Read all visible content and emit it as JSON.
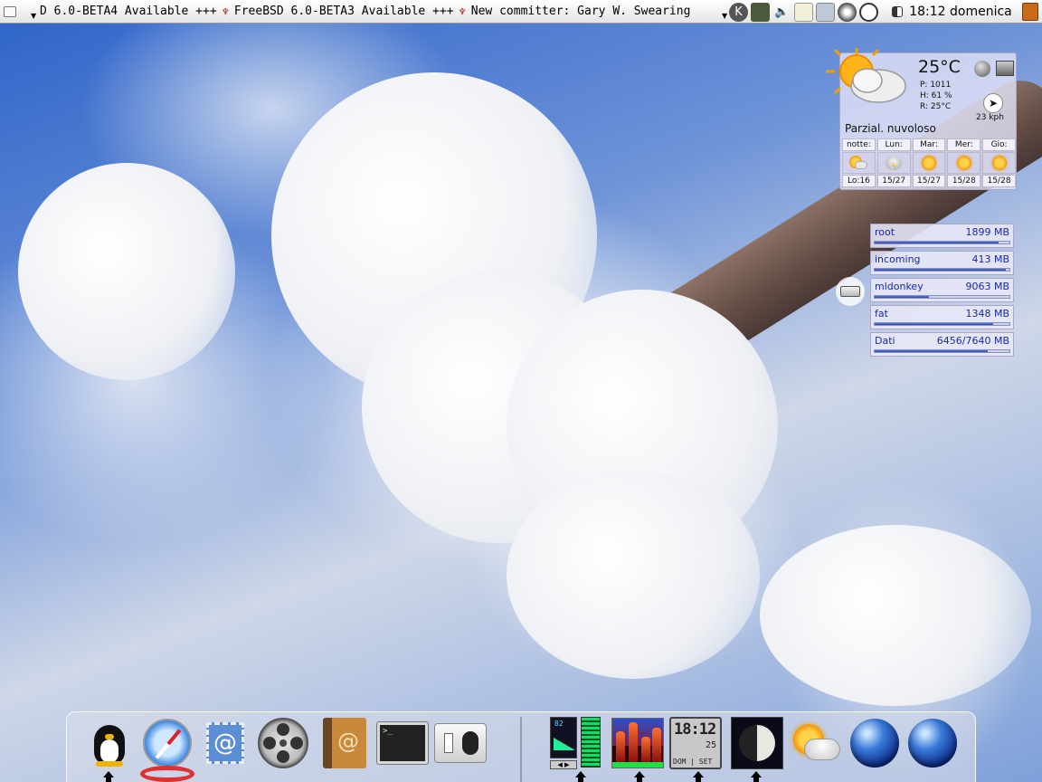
{
  "topbar": {
    "ticker": [
      "D 6.0-BETA4 Available +++",
      "FreeBSD 6.0-BETA3 Available +++",
      "New committer: Gary W. Swearing"
    ],
    "clock": "18:12 domenica",
    "tray_icons": [
      "kde-icon",
      "monitor-icon",
      "volume-icon",
      "notes-icon",
      "network-icon",
      "weather-icon",
      "clock-icon",
      "workspace-icon"
    ]
  },
  "weather": {
    "temperature": "25°C",
    "pressure": "P:  1011",
    "humidity": "H:  61 %",
    "real": "R:  25°C",
    "wind": "23 kph",
    "condition": "Parzial. nuvoloso",
    "forecast": [
      {
        "day": "notte:",
        "temp": "Lo:16",
        "icon": "night-sun-cloud"
      },
      {
        "day": "Lun:",
        "temp": "15/27",
        "icon": "thunderstorm"
      },
      {
        "day": "Mar:",
        "temp": "15/27",
        "icon": "sunny"
      },
      {
        "day": "Mer:",
        "temp": "15/28",
        "icon": "sunny"
      },
      {
        "day": "Gio:",
        "temp": "15/28",
        "icon": "sunny"
      }
    ]
  },
  "disks": [
    {
      "name": "root",
      "size": "1899 MB",
      "fill": 0.92
    },
    {
      "name": "incoming",
      "size": "413 MB",
      "fill": 0.97
    },
    {
      "name": "mldonkey",
      "size": "9063 MB",
      "fill": 0.4
    },
    {
      "name": "fat",
      "size": "1348 MB",
      "fill": 0.88
    },
    {
      "name": "Dati",
      "size": "6456/7640 MB",
      "fill": 0.84
    }
  ],
  "dock": {
    "launchers": [
      "finder-penguin",
      "safari",
      "mail",
      "media-player",
      "address-book",
      "terminal",
      "system-preferences"
    ],
    "applets": {
      "mixer_value": "82",
      "clock_time": "18:12",
      "clock_day": "25",
      "clock_weekday": "DOM",
      "clock_set": "SET"
    }
  }
}
